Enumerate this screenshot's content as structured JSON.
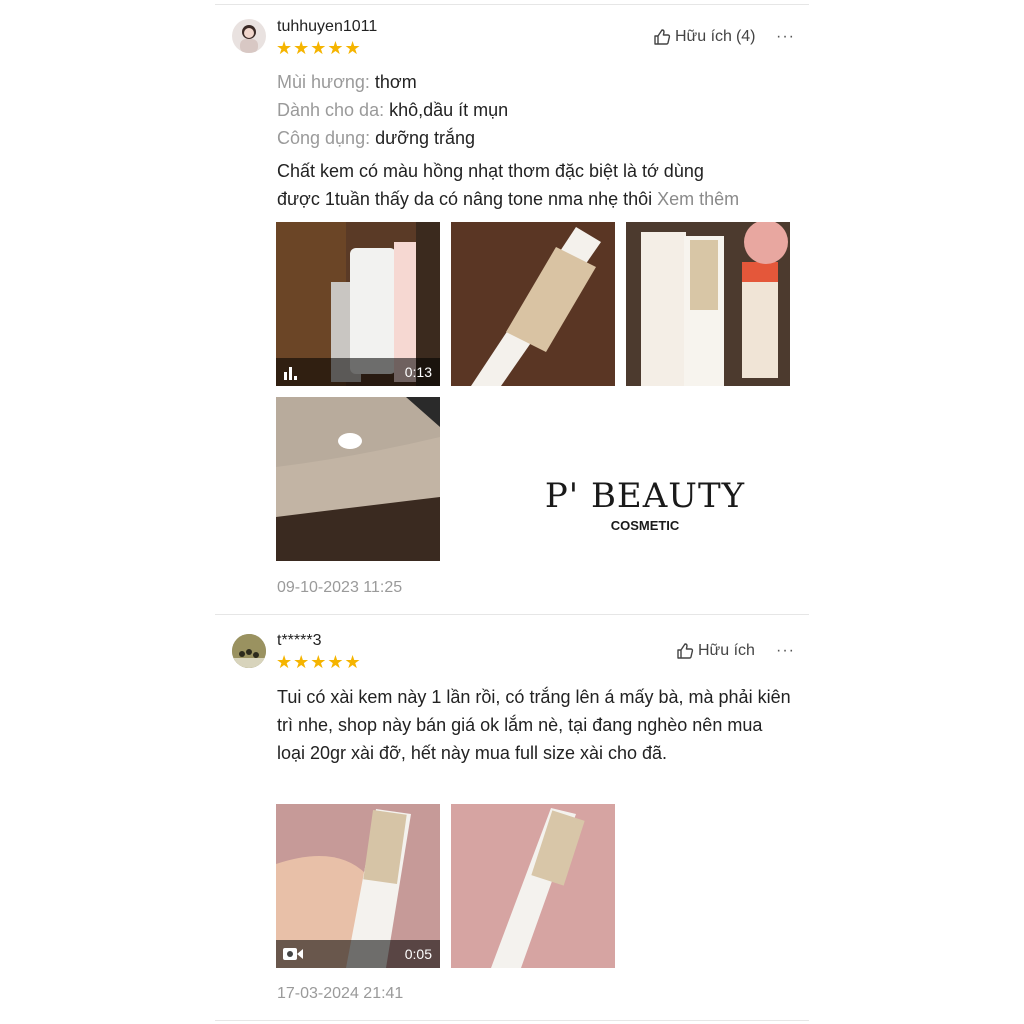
{
  "reviews": [
    {
      "username": "tuhhuyen1011",
      "stars": "★★★★★",
      "helpful_label": "Hữu ích",
      "helpful_count": "(4)",
      "more": "···",
      "attributes": [
        {
          "key": "Mùi hương:",
          "value": "thơm"
        },
        {
          "key": "Dành cho da:",
          "value": "khô,dầu ít mụn"
        },
        {
          "key": "Công dụng:",
          "value": "dưỡng trắng"
        }
      ],
      "text_line1": "Chất kem có màu hồng nhạt thơm đặc biệt là tớ dùng",
      "text_line2": "được 1tuần thấy da có nâng tone nma nhẹ thôi",
      "see_more": "Xem thêm",
      "video_duration": "0:13",
      "logo_main": "P' BEAUTY",
      "logo_sub": "COSMETIC",
      "timestamp": "09-10-2023 11:25"
    },
    {
      "username": "t*****3",
      "stars": "★★★★★",
      "helpful_label": "Hữu ích",
      "more": "···",
      "text": "Tui có xài kem này 1 lần rồi, có trắng lên á mấy bà, mà phải kiên trì nhe, shop này bán giá ok lắm nè, tại đang nghèo nên mua loại 20gr xài đỡ, hết này mua full size xài cho đã.",
      "video_duration": "0:05",
      "timestamp": "17-03-2024 21:41"
    }
  ],
  "colors": {
    "star": "#f5b400",
    "muted": "#9a9a9a",
    "divider": "#e6e6e6"
  }
}
